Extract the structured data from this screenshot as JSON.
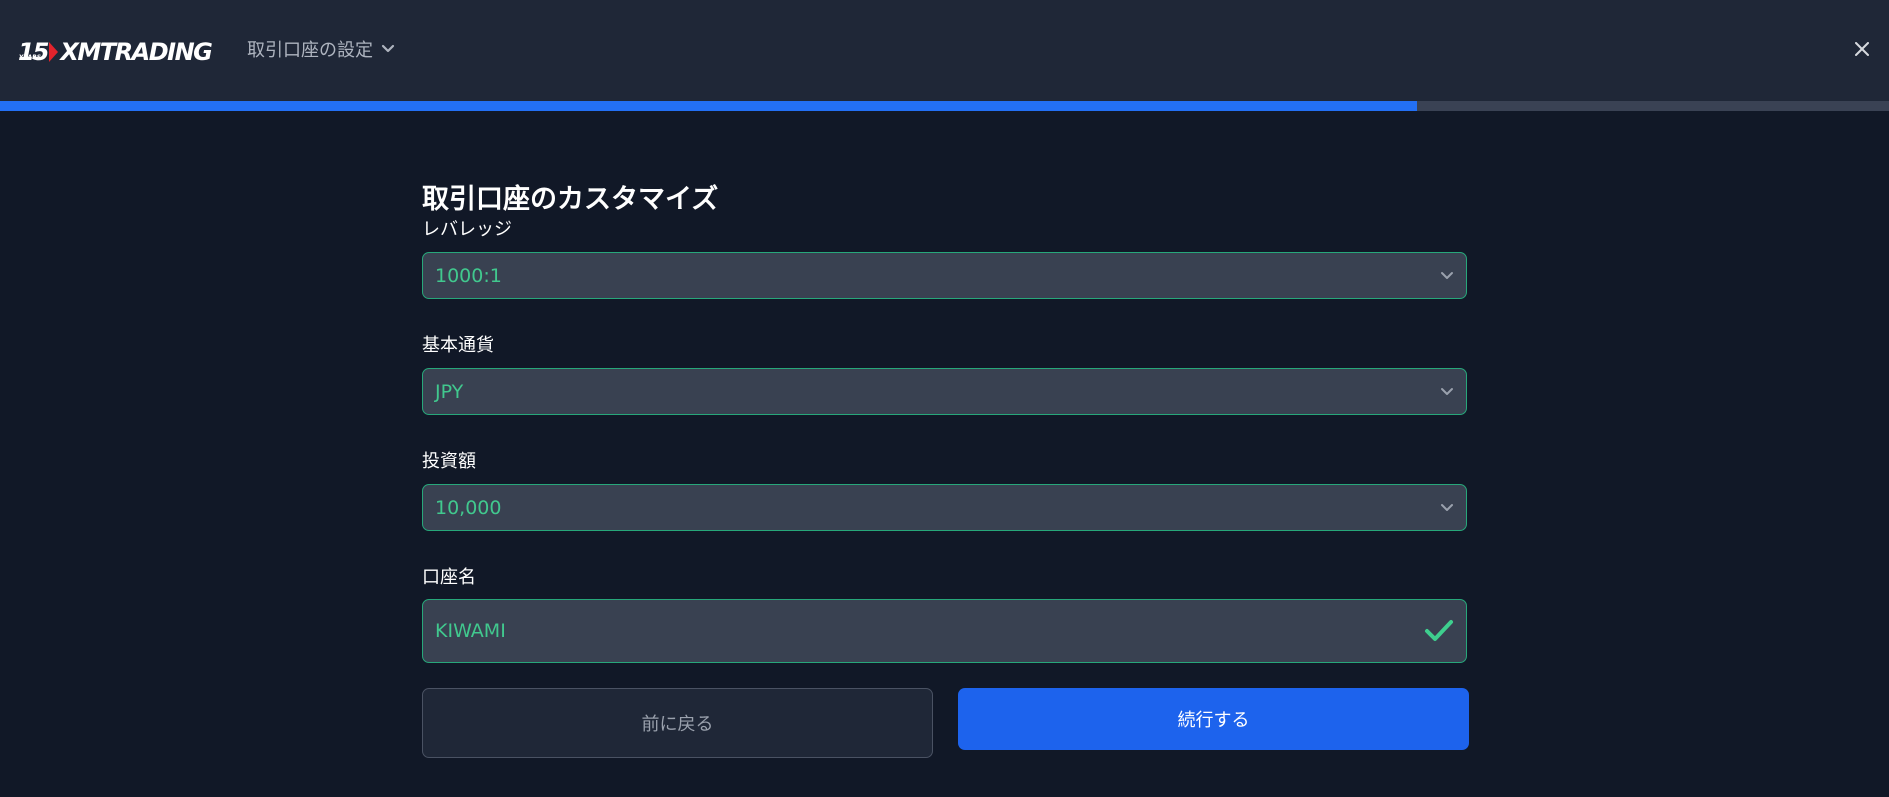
{
  "colors": {
    "background": "#111827",
    "header": "#1f2737",
    "accent_blue": "#2370f5",
    "field_border": "#27a77a",
    "field_value": "#41c88e"
  },
  "header": {
    "logo": {
      "years_number": "15",
      "years_label": "YEARS",
      "brand": "XMTRADING"
    },
    "step_title": "取引口座の設定",
    "step_icon": "chevron-down-icon",
    "close_icon": "close-icon"
  },
  "progress": {
    "fraction": 0.75
  },
  "form": {
    "title": "取引口座のカスタマイズ",
    "leverage": {
      "label": "レバレッジ",
      "value": "1000:1",
      "icon": "chevron-down-icon"
    },
    "base_currency": {
      "label": "基本通貨",
      "value": "JPY",
      "icon": "chevron-down-icon"
    },
    "investment": {
      "label": "投資額",
      "value": "10,000",
      "icon": "chevron-down-icon"
    },
    "account_name": {
      "label": "口座名",
      "value": "KIWAMI",
      "icon": "check-icon"
    },
    "back_label": "前に戻る",
    "continue_label": "続行する"
  }
}
